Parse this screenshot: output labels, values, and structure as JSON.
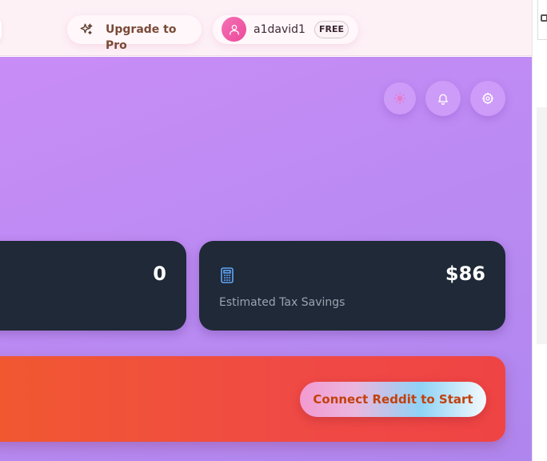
{
  "header": {
    "upgrade": {
      "label": "Upgrade to Pro",
      "icon": "sparkles-icon"
    },
    "user": {
      "username": "a1david1",
      "plan": "FREE",
      "avatar_icon": "user-icon"
    }
  },
  "toolbar": {
    "icons": [
      "sun-icon",
      "bell-icon",
      "gear-icon"
    ]
  },
  "stats": [
    {
      "value": "0"
    },
    {
      "value": "$86",
      "label": "Estimated Tax Savings",
      "icon": "calculator-icon"
    }
  ],
  "cta": {
    "button_label": "Connect Reddit to Start"
  },
  "colors": {
    "main_gradient_start": "#c98cf6",
    "main_gradient_end": "#af86ee",
    "card_bg": "#1f2937",
    "banner": "#f04a45",
    "cta_text": "#c2410c",
    "topbar_bg": "#fdf1f6"
  }
}
